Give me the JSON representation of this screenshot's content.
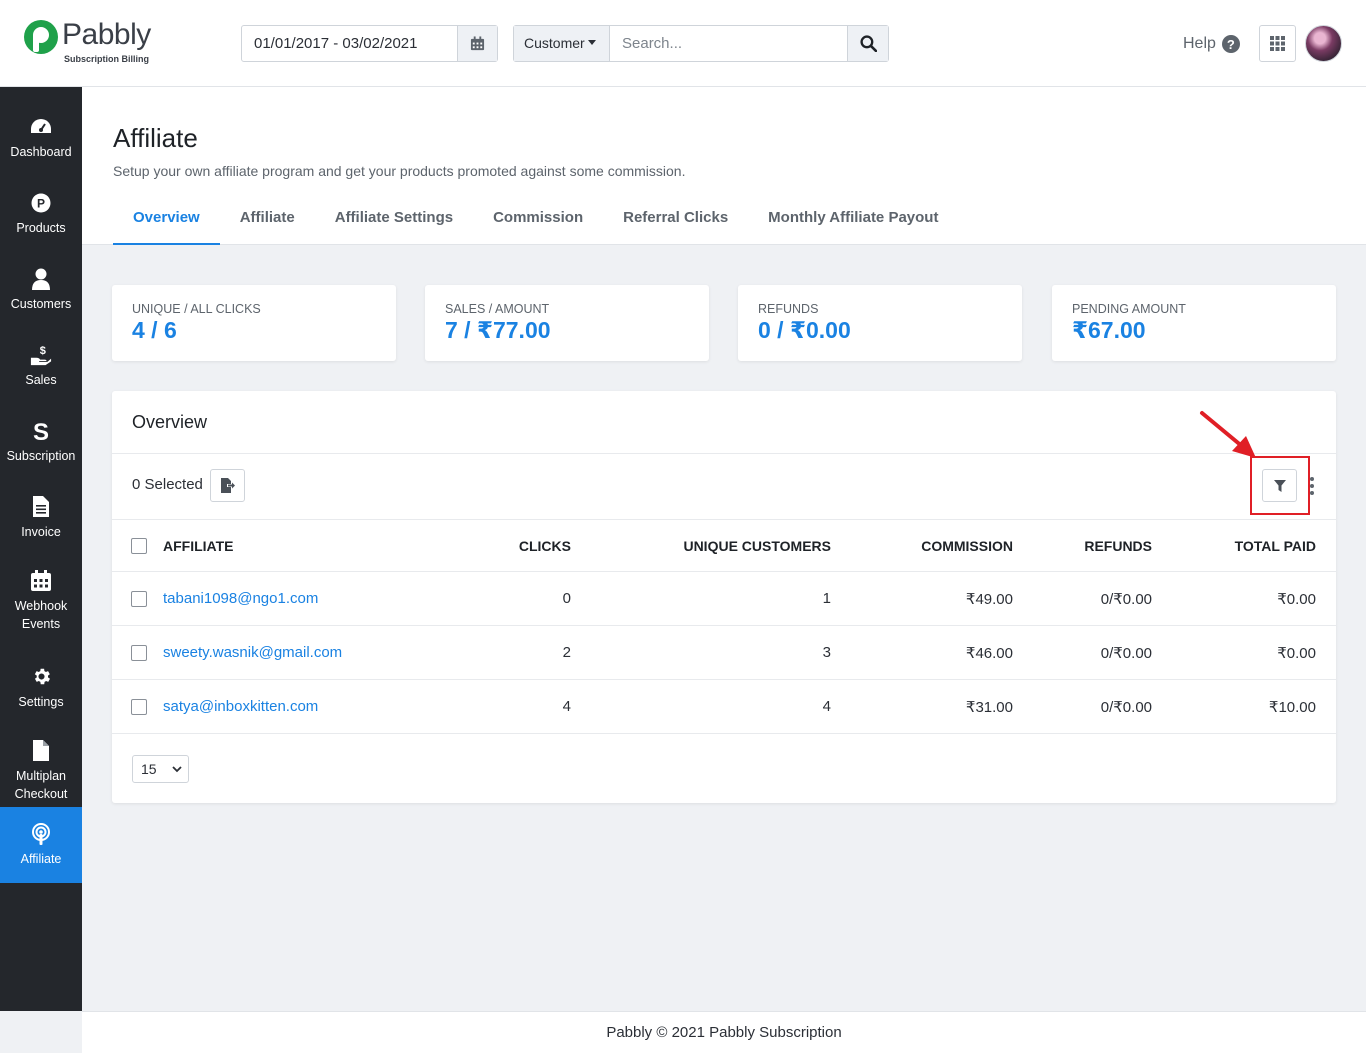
{
  "brand": {
    "name": "Pabbly",
    "sub": "Subscription Billing"
  },
  "header": {
    "date_range": "01/01/2017 - 03/02/2021",
    "search_category": "Customer",
    "search_placeholder": "Search...",
    "help_label": "Help"
  },
  "sidebar": {
    "items": [
      {
        "label": "Dashboard",
        "icon": "gauge-icon"
      },
      {
        "label": "Products",
        "icon": "product-p-icon"
      },
      {
        "label": "Customers",
        "icon": "user-icon"
      },
      {
        "label": "Sales",
        "icon": "hand-dollar-icon"
      },
      {
        "label": "Subscription",
        "icon": "subscription-s-icon"
      },
      {
        "label": "Invoice",
        "icon": "document-icon"
      },
      {
        "label": "Webhook Events",
        "icon": "calendar-icon"
      },
      {
        "label": "Settings",
        "icon": "gear-icon"
      },
      {
        "label": "Multiplan Checkout",
        "icon": "file-icon"
      },
      {
        "label": "Affiliate",
        "icon": "broadcast-icon",
        "active": true
      }
    ]
  },
  "page": {
    "title": "Affiliate",
    "subtitle": "Setup your own affiliate program and get your products promoted against some commission.",
    "tabs": [
      "Overview",
      "Affiliate",
      "Affiliate Settings",
      "Commission",
      "Referral Clicks",
      "Monthly Affiliate Payout"
    ],
    "active_tab": "Overview"
  },
  "stats": [
    {
      "label": "UNIQUE / ALL CLICKS",
      "value": "4 / 6"
    },
    {
      "label": "SALES / AMOUNT",
      "value": "7 / ₹77.00"
    },
    {
      "label": "REFUNDS",
      "value": "0 / ₹0.00"
    },
    {
      "label": "PENDING AMOUNT",
      "value": "₹67.00"
    }
  ],
  "overview": {
    "title": "Overview",
    "selected": "0 Selected",
    "columns": [
      "AFFILIATE",
      "CLICKS",
      "UNIQUE CUSTOMERS",
      "COMMISSION",
      "REFUNDS",
      "TOTAL PAID"
    ],
    "rows": [
      {
        "affiliate": "tabani1098@ngo1.com",
        "clicks": "0",
        "unique_customers": "1",
        "commission": "₹49.00",
        "refunds": "0/₹0.00",
        "total_paid": "₹0.00"
      },
      {
        "affiliate": "sweety.wasnik@gmail.com",
        "clicks": "2",
        "unique_customers": "3",
        "commission": "₹46.00",
        "refunds": "0/₹0.00",
        "total_paid": "₹0.00"
      },
      {
        "affiliate": "satya@inboxkitten.com",
        "clicks": "4",
        "unique_customers": "4",
        "commission": "₹31.00",
        "refunds": "0/₹0.00",
        "total_paid": "₹10.00"
      }
    ],
    "page_size": "15"
  },
  "footer": {
    "text": "Pabbly © 2021 Pabbly Subscription"
  },
  "colors": {
    "accent": "#1a82e2",
    "sidebar_bg": "#24272c",
    "highlight": "#e01f26"
  }
}
